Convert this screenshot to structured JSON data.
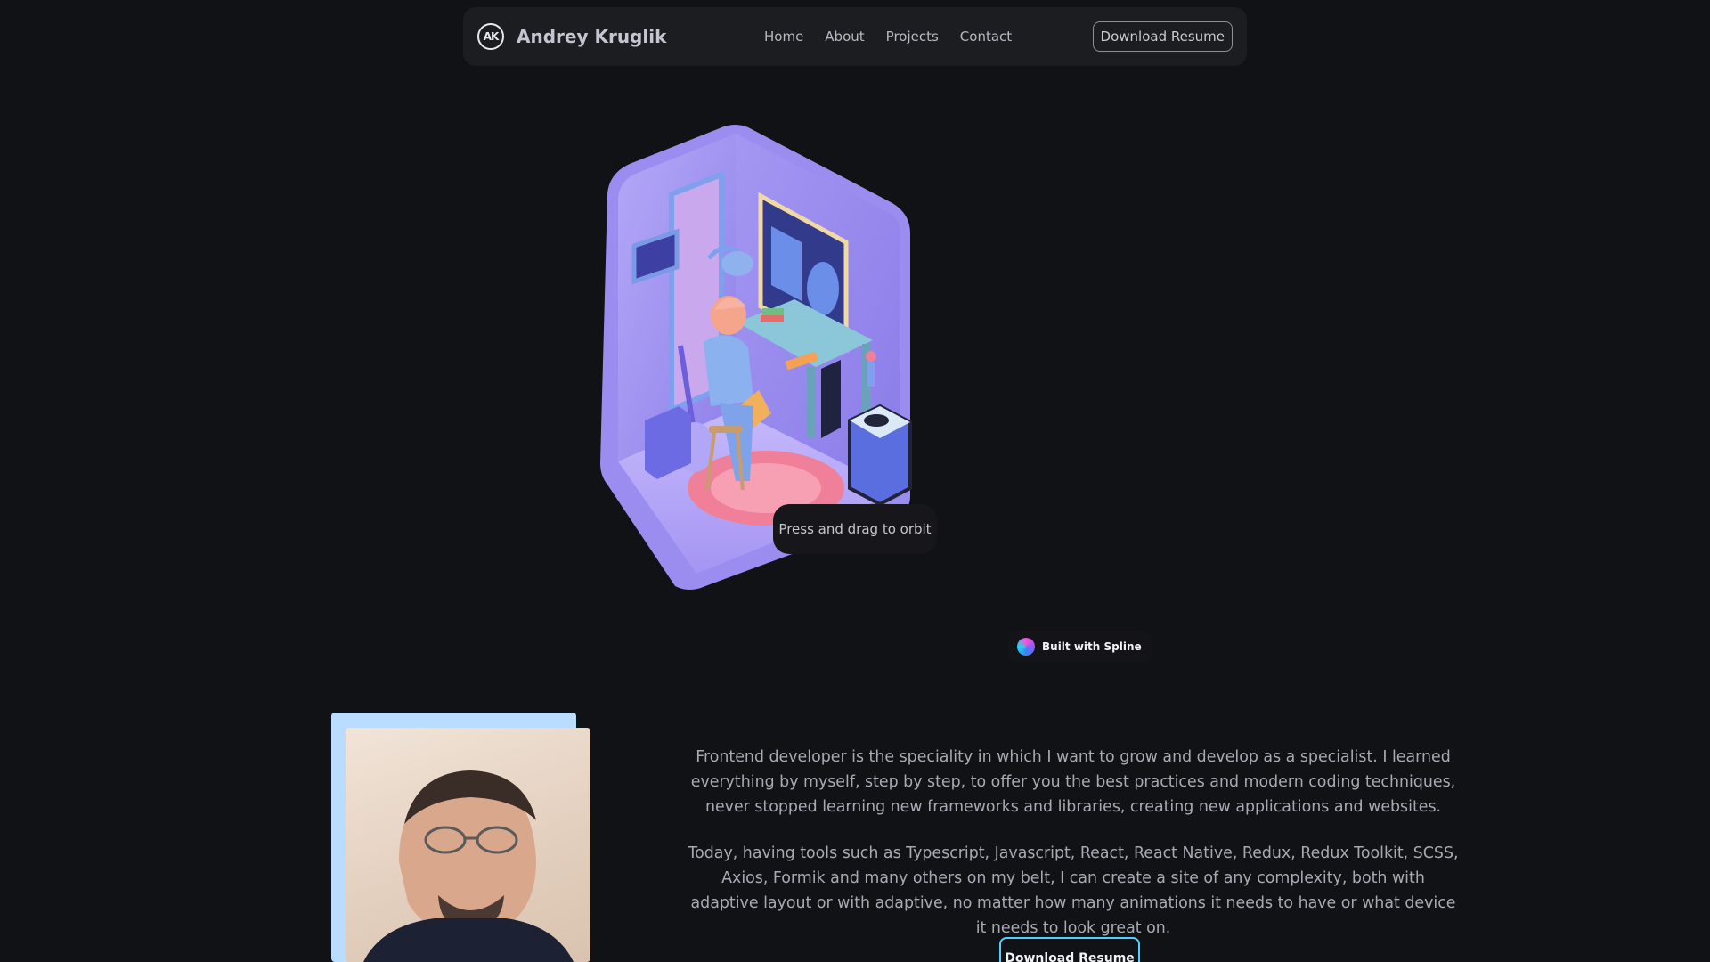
{
  "navbar": {
    "logo_text": "AK",
    "brand_name": "Andrey Kruglik",
    "links": [
      "Home",
      "About",
      "Projects",
      "Contact"
    ],
    "cta_label": "Download Resume"
  },
  "hero": {
    "orbit_hint": "Press and drag to orbit",
    "spline_badge": "Built with Spline"
  },
  "about": {
    "paragraphs": [
      "Frontend developer is the speciality in which I want to grow and develop as a specialist. I learned everything by myself, step by step, to offer you the best practices and modern coding techniques, never stopped learning new frameworks and libraries, creating new applications and websites.",
      "Today, having tools such as Typescript, Javascript, React, React Native, Redux, Redux Toolkit, SCSS, Axios, Formik and many others on my belt, I can create a site of any complexity, both with adaptive layout or with adaptive, no matter how many animations it needs to have or what device it needs to look great on."
    ],
    "cta_label": "Download Resume"
  },
  "colors": {
    "background": "#111215",
    "navbar": "#1c1d21",
    "room_wall": "#9e91f0",
    "accent_cyan": "#4fd1ff",
    "photo_frame": "#b9dcff"
  }
}
